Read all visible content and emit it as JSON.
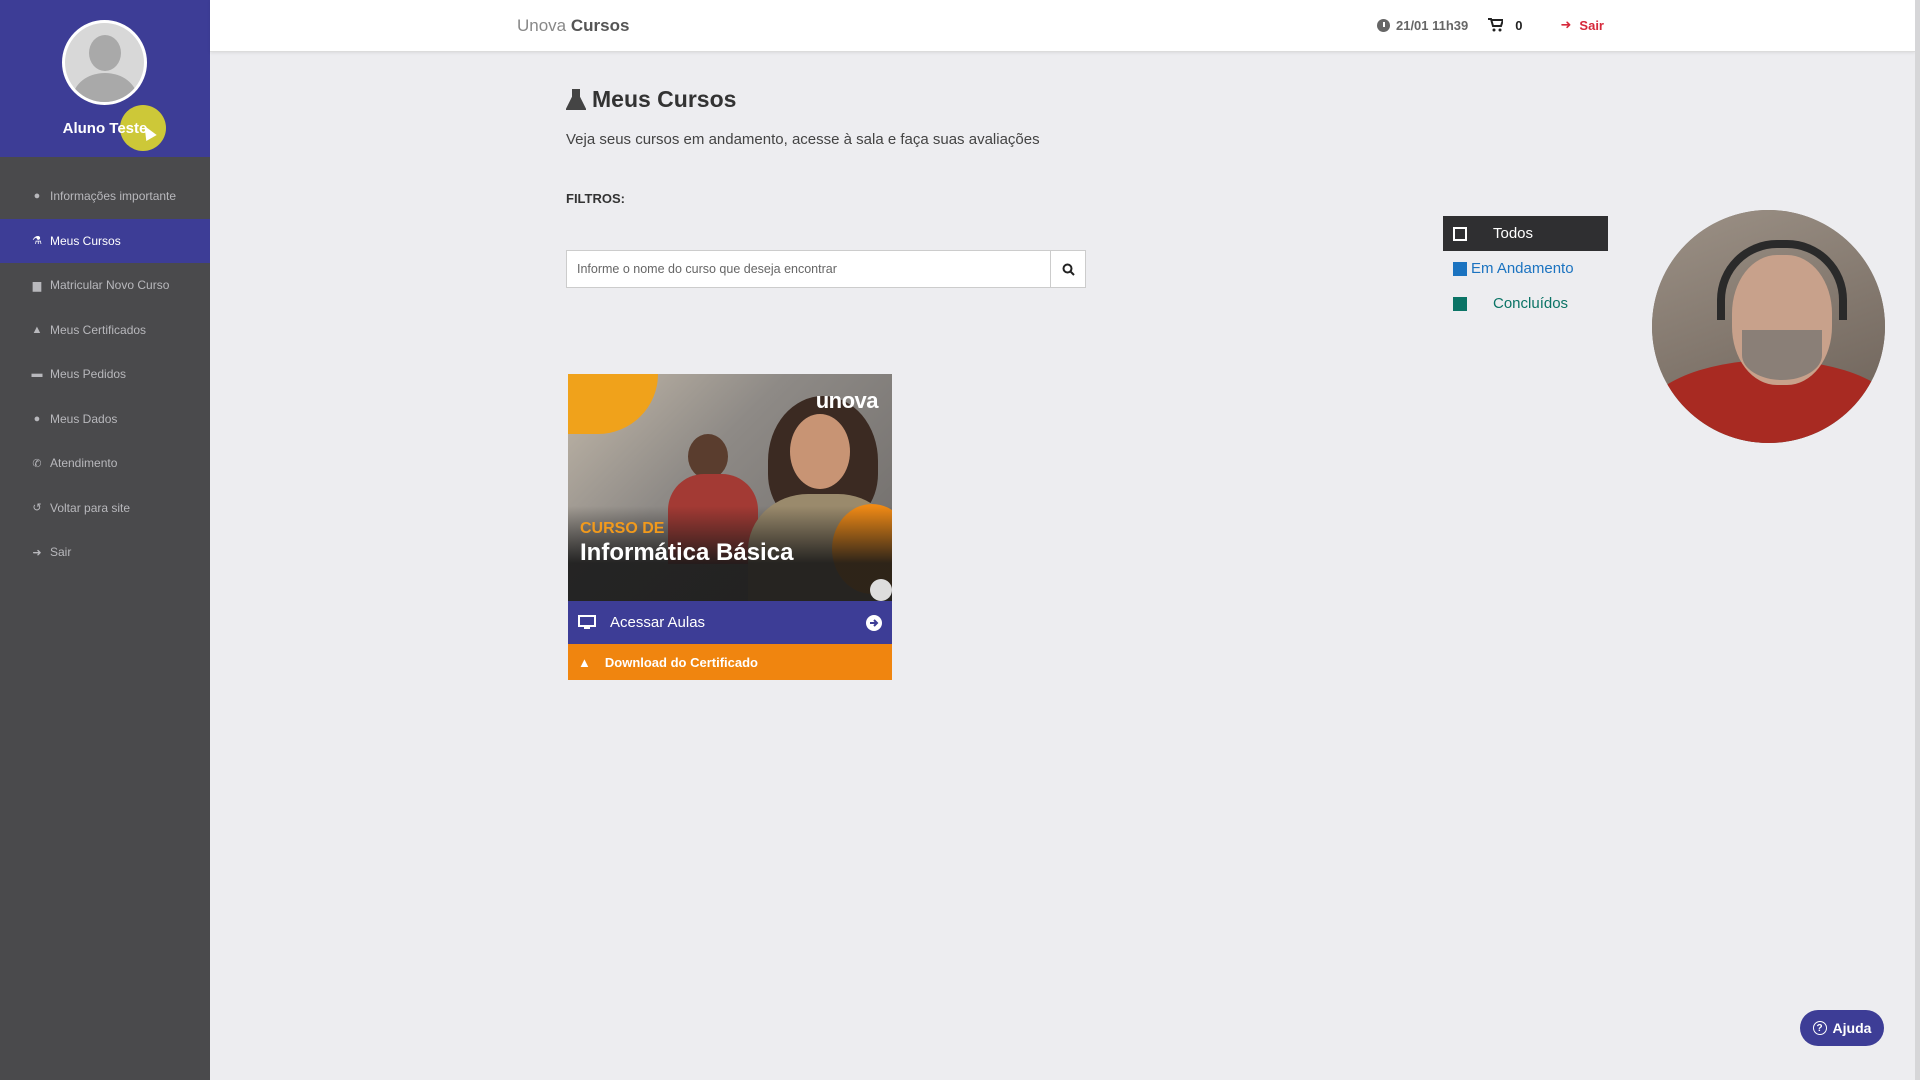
{
  "user": {
    "name": "Aluno Teste"
  },
  "sidebar": {
    "items": [
      {
        "label": "Informações importante",
        "icon": "info-icon"
      },
      {
        "label": "Meus Cursos",
        "icon": "flask-icon",
        "active": true
      },
      {
        "label": "Matricular Novo Curso",
        "icon": "book-icon"
      },
      {
        "label": "Meus Certificados",
        "icon": "graduation-cap-icon"
      },
      {
        "label": "Meus Pedidos",
        "icon": "credit-card-icon"
      },
      {
        "label": "Meus Dados",
        "icon": "user-icon"
      },
      {
        "label": "Atendimento",
        "icon": "phone-icon"
      },
      {
        "label": "Voltar para site",
        "icon": "undo-icon"
      },
      {
        "label": "Sair",
        "icon": "sign-out-icon"
      }
    ]
  },
  "topbar": {
    "brand_light": "Unova",
    "brand_bold": "Cursos",
    "datetime": "21/01 11h39",
    "cart_count": "0",
    "logout": "Sair"
  },
  "main": {
    "title": "Meus Cursos",
    "subtitle": "Veja seus cursos em andamento, acesse à sala e faça suas avaliações",
    "filters_label": "FILTROS:",
    "search_placeholder": "Informe o nome do curso que deseja encontrar"
  },
  "status_filters": [
    {
      "label": "Todos"
    },
    {
      "label": "Em Andamento"
    },
    {
      "label": "Concluídos"
    }
  ],
  "course": {
    "logo_text": "unova",
    "image_line1": "CURSO DE",
    "image_line2": "Informática Básica",
    "access_label": "Acessar Aulas",
    "certificate_label": "Download do Certificado"
  },
  "help": {
    "label": "Ajuda"
  },
  "colors": {
    "primary": "#3d3d96",
    "sidebar": "#4a4a4c",
    "orange": "#f0850f",
    "danger": "#d6283a",
    "in_progress": "#1b73c0",
    "completed": "#0b7466"
  }
}
